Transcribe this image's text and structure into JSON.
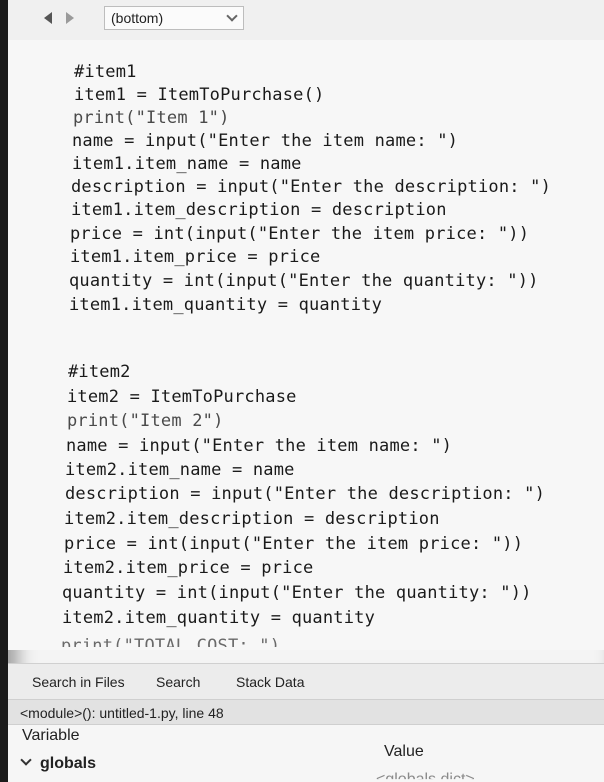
{
  "navigation": {
    "back_icon": "back-arrow-icon",
    "forward_icon": "forward-arrow-icon",
    "scope_selected": "(bottom)"
  },
  "editor": {
    "lines": [
      "#item1",
      "item1 = ItemToPurchase()",
      "print(\"Item 1\")",
      "name = input(\"Enter the item name: \")",
      "item1.item_name = name",
      "description = input(\"Enter the description: \")",
      "item1.item_description = description",
      "price = int(input(\"Enter the item price: \"))",
      "item1.item_price = price",
      "quantity = int(input(\"Enter the quantity: \"))",
      "item1.item_quantity = quantity",
      "#item2",
      "item2 = ItemToPurchase",
      "print(\"Item 2\")",
      "name = input(\"Enter the item name: \")",
      "item2.item_name = name",
      "description = input(\"Enter the description: \")",
      "item2.item_description = description",
      "price = int(input(\"Enter the item price: \"))",
      "item2.item_price = price",
      "quantity = int(input(\"Enter the quantity: \"))",
      "item2.item_quantity = quantity",
      "print(\"TOTAL COST: \")"
    ]
  },
  "bottom_panel": {
    "tabs": [
      "Search in Files",
      "Search",
      "Stack Data"
    ],
    "status": "<module>(): untitled-1.py, line 48",
    "variable_header": "Variable",
    "value_header": "Value",
    "globals_label": "globals",
    "globals_value": "<globals dict>"
  }
}
